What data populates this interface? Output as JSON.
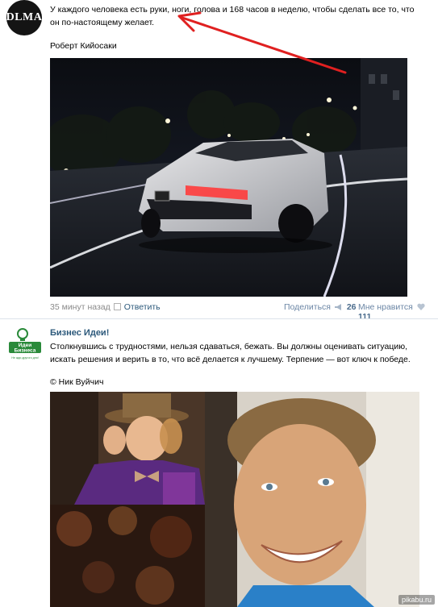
{
  "post1": {
    "avatar_text": "DLMA",
    "text": "У каждого человека есть руки, ноги, голова и 168 часов в неделю, чтобы сделать все то, что он по-настоящему желает.",
    "author": "Роберт Кийосаки",
    "meta": {
      "time": "35 минут назад",
      "reply": "Ответить",
      "share_label": "Поделиться",
      "share_count": "26",
      "like_label": "Мне нравится",
      "like_count": "111"
    }
  },
  "post2": {
    "avatar_line1": "Идеи",
    "avatar_line2": "Бизнеса",
    "avatar_line3": "Не жди другого дня!",
    "group_name": "Бизнес Идеи!",
    "text": "Столкнувшись с трудностями, нельзя сдаваться, бежать. Вы должны оценивать ситуацию, искать решения и верить в то, что всё делается к лучшему. Терпение — вот ключ к победе.",
    "author": "© Ник Вуйчич"
  },
  "watermark": "pikabu.ru",
  "colors": {
    "link": "#2b587a",
    "meta_gray": "#8a8a8a",
    "arrow_red": "#e02020",
    "logo_green": "#2a8a3a"
  },
  "icons": {
    "share": "megaphone-icon",
    "like": "heart-icon",
    "separator": "comment-box-icon"
  }
}
